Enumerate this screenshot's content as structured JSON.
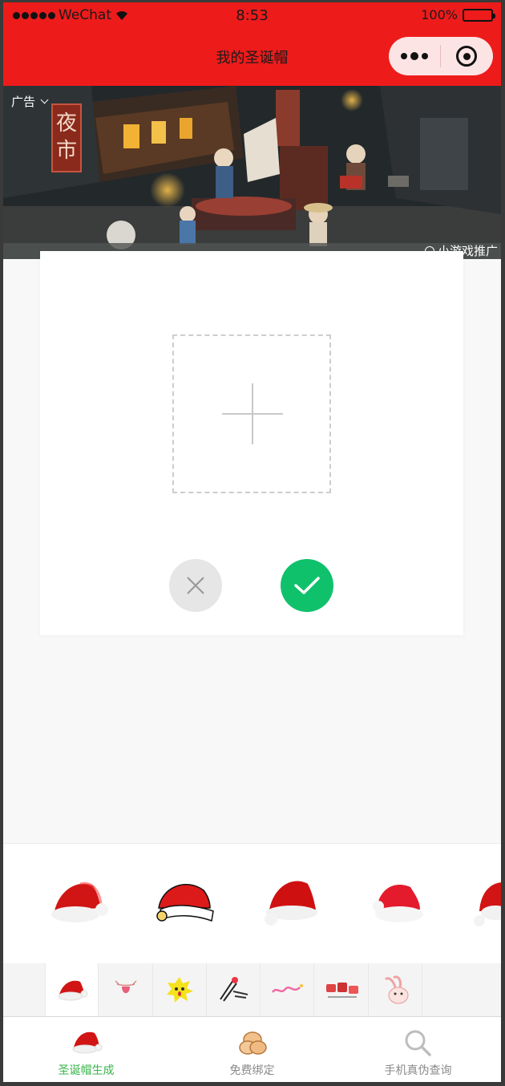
{
  "status_bar": {
    "carrier": "WeChat",
    "time": "8:53",
    "battery": "100%"
  },
  "nav": {
    "title": "我的圣诞帽"
  },
  "ad": {
    "label": "广告",
    "sign_text": [
      "夜",
      "市"
    ],
    "promo": "小游戏推广"
  },
  "editor": {
    "upload_hint": "",
    "cancel": "",
    "confirm": ""
  },
  "colors": {
    "nav_bg": "#ee1b1b",
    "confirm": "#10c16c",
    "active_tab": "#36b54a"
  },
  "tabbar": {
    "items": [
      {
        "label": "圣诞帽生成",
        "icon": "santa-hat-icon"
      },
      {
        "label": "免费绑定",
        "icon": "coins-icon"
      },
      {
        "label": "手机真伪查询",
        "icon": "search-icon"
      }
    ]
  }
}
